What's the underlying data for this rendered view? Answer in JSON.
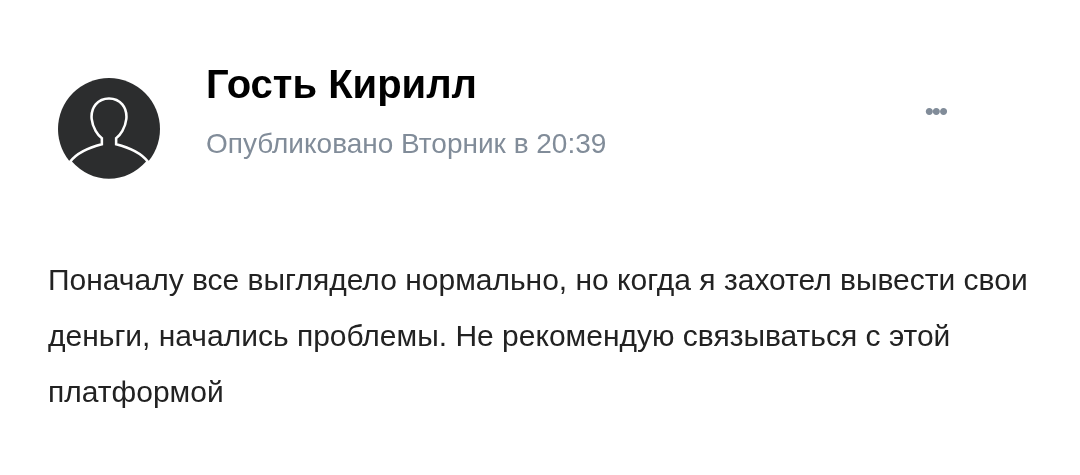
{
  "post": {
    "author": "Гость Кирилл",
    "published": "Опубликовано Вторник в 20:39",
    "menu": "•••",
    "text": "Поначалу все выглядело нормально, но когда я захотел вывести свои деньги, начались проблемы. Не рекомендую связываться с этой платформой"
  }
}
